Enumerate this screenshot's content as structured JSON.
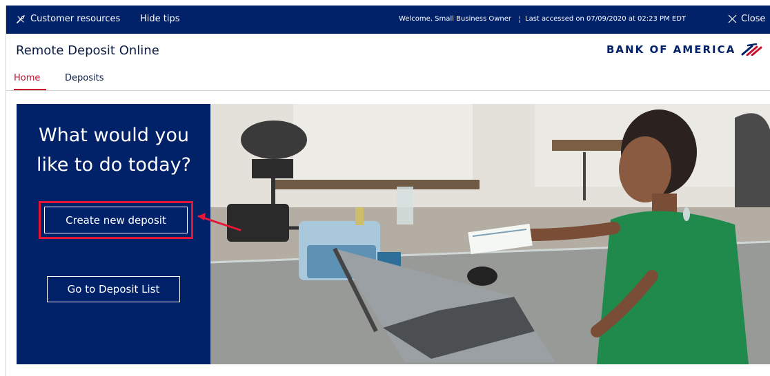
{
  "topbar": {
    "customer_resources": "Customer resources",
    "hide_tips": "Hide tips",
    "welcome": "Welcome, Small Business Owner",
    "separator": "¦",
    "last_accessed": "Last accessed on 07/09/2020 at 02:23 PM EDT",
    "close": "Close"
  },
  "header": {
    "app_title": "Remote Deposit Online",
    "logo_text": "BANK OF AMERICA"
  },
  "tabs": [
    {
      "label": "Home",
      "active": true
    },
    {
      "label": "Deposits",
      "active": false
    }
  ],
  "hero": {
    "question": "What would you like to do today?",
    "create_button": "Create new deposit",
    "list_button": "Go to Deposit List"
  },
  "colors": {
    "navy": "#012169",
    "red": "#e31837",
    "active_tab": "#c8102e"
  },
  "icons": [
    "wrench-icon",
    "close-icon",
    "flag-logo-icon",
    "callout-arrow-icon"
  ]
}
